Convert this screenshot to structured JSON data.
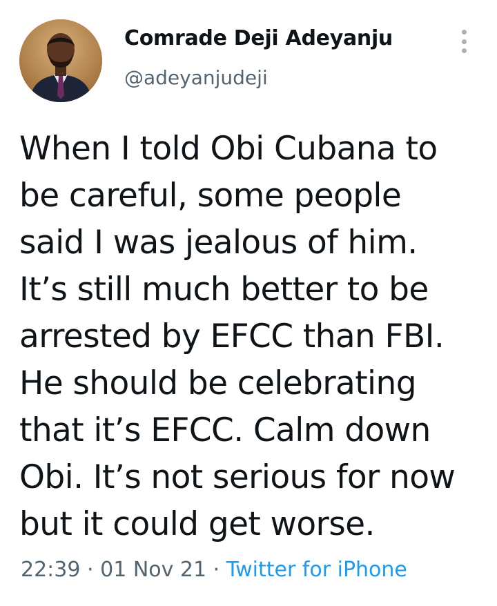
{
  "author": {
    "display_name": "Comrade Deji Adeyanju",
    "handle": "@adeyanjudeji"
  },
  "tweet": {
    "lines": [
      "When I told Obi Cubana to",
      "be careful, some people",
      "said I was jealous of him.",
      "It’s still much better to be",
      "arrested by EFCC than FBI.",
      "He should be celebrating",
      "that it’s EFCC. Calm down",
      "Obi. It’s not serious for now",
      "but it could get worse."
    ],
    "time": "22:39",
    "date": "01 Nov 21",
    "separator": "·",
    "source": "Twitter for iPhone"
  },
  "icons": {
    "more": "more-vertical-icon",
    "avatar": "profile-photo"
  },
  "colors": {
    "text": "#0f1419",
    "secondary": "#536471",
    "link": "#1d9bf0"
  }
}
